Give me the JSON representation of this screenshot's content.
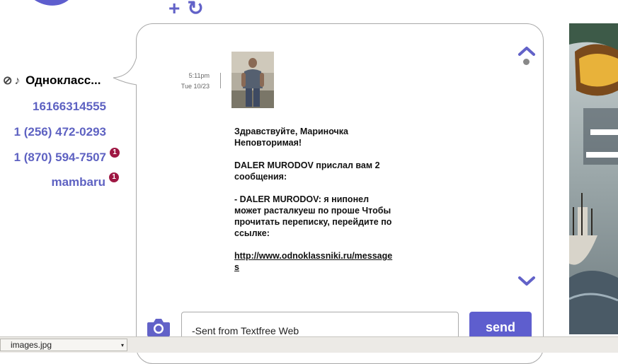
{
  "header": {
    "logo_icon": "textfree-logo-icon",
    "actions": [
      {
        "icon": "plus-icon",
        "glyph": "+"
      },
      {
        "icon": "refresh-icon",
        "glyph": "↻"
      }
    ]
  },
  "sidebar": {
    "items": [
      {
        "label": "Однокласс...",
        "badge": "",
        "active": true,
        "icons": [
          "⊘",
          "♪"
        ]
      },
      {
        "label": "16166314555",
        "badge": ""
      },
      {
        "label": "1 (256) 472-0293",
        "badge": ""
      },
      {
        "label": "1 (870) 594-7507",
        "badge": "1"
      },
      {
        "label": "mambaru",
        "badge": "1"
      }
    ]
  },
  "conversation": {
    "message": {
      "time": "5:11pm",
      "date": "Tue 10/23",
      "lines": [
        "Здравствуйте, Мариночка Неповторимая!",
        "DALER MURODOV прислал вам 2 сообщения:",
        "- DALER MURODOV: я нипонел может расталкуеш по проше Чтобы прочитать переписку, перейдите по ссылке:"
      ],
      "link": "http://www.odnoklassniki.ru/messages"
    }
  },
  "composer": {
    "value": "-Sent from Textfree Web",
    "send_label": "send"
  },
  "download_bar": {
    "filename": "images.jpg",
    "caret": "▾"
  },
  "colors": {
    "accent": "#5e5ece",
    "badge": "#9e1743",
    "link_text": "#5e62c2"
  }
}
